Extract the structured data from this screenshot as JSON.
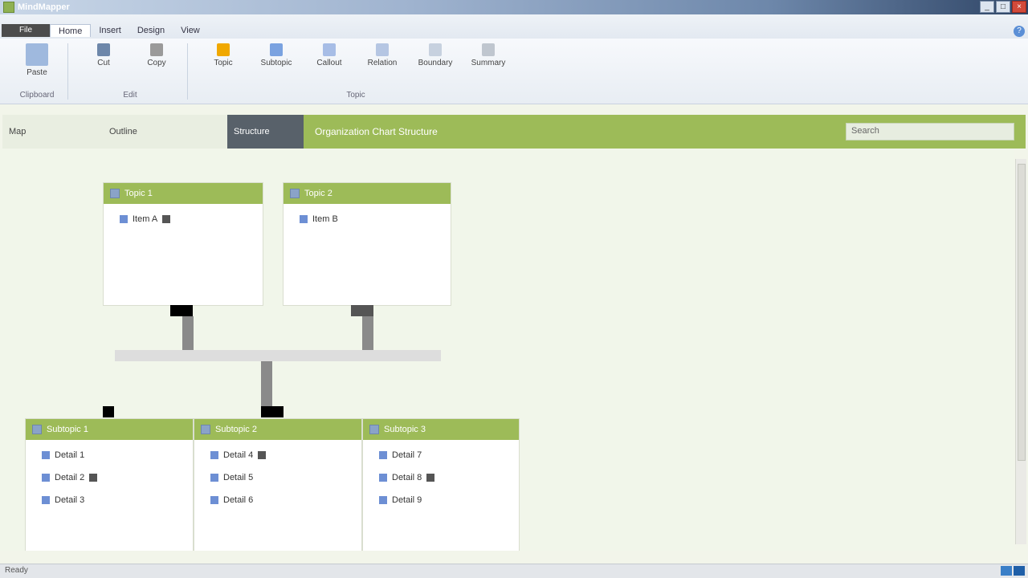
{
  "window": {
    "title": "MindMapper",
    "controls": [
      "_",
      "□",
      "×"
    ]
  },
  "menu": {
    "app_button": "File",
    "tabs": [
      "Home",
      "Insert",
      "Design",
      "View"
    ],
    "help": "?"
  },
  "ribbon": {
    "groups": [
      {
        "name": "Clipboard",
        "tools": [
          {
            "label": "Paste",
            "icon": "paste-icon",
            "color": "#9fb9de"
          }
        ]
      },
      {
        "name": "Edit",
        "tools": [
          {
            "label": "Cut",
            "icon": "cut-icon",
            "color": "#6d87aa"
          },
          {
            "label": "Copy",
            "icon": "copy-icon",
            "color": "#9a9a9a"
          }
        ]
      },
      {
        "name": "Topic",
        "tools": [
          {
            "label": "Topic",
            "icon": "topic-icon",
            "color": "#f0a800"
          },
          {
            "label": "Subtopic",
            "icon": "subtopic-icon",
            "color": "#7aa2e0"
          },
          {
            "label": "Callout",
            "icon": "callout-icon",
            "color": "#a7bde6"
          },
          {
            "label": "Relation",
            "icon": "relation-icon",
            "color": "#b5c6e3"
          },
          {
            "label": "Boundary",
            "icon": "boundary-icon",
            "color": "#c7d1df"
          },
          {
            "label": "Summary",
            "icon": "summary-icon",
            "color": "#bfc6cf"
          }
        ]
      }
    ]
  },
  "structure_bar": {
    "tabs": [
      "Map",
      "Outline",
      "Structure"
    ],
    "active_tab": "Structure",
    "label": "Organization Chart Structure",
    "search_placeholder": "Search"
  },
  "nodes": {
    "top": [
      {
        "title": "Topic 1",
        "items": [
          "Item A"
        ]
      },
      {
        "title": "Topic 2",
        "items": [
          "Item B"
        ]
      }
    ],
    "bottom": [
      {
        "title": "Subtopic 1",
        "items": [
          "Detail 1",
          "Detail 2",
          "Detail 3"
        ]
      },
      {
        "title": "Subtopic 2",
        "items": [
          "Detail 4",
          "Detail 5",
          "Detail 6"
        ]
      },
      {
        "title": "Subtopic 3",
        "items": [
          "Detail 7",
          "Detail 8",
          "Detail 9"
        ]
      }
    ]
  },
  "status": {
    "text": "Ready"
  },
  "colors": {
    "accent_green": "#9dbb58",
    "canvas_bg": "#f1f6ea"
  }
}
